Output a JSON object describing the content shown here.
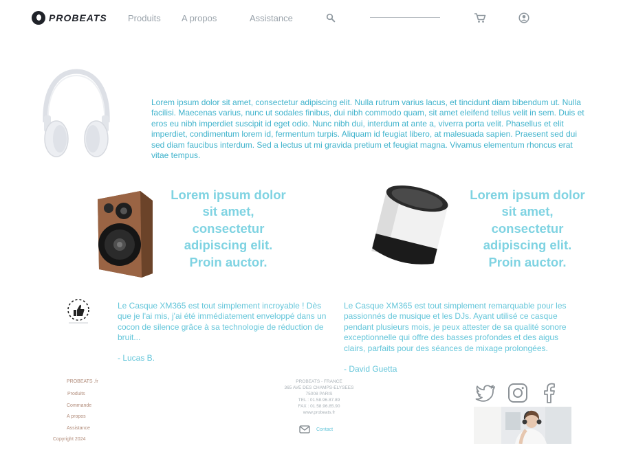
{
  "header": {
    "logo_text": "PROBEATS",
    "nav": [
      "Produits",
      "A propos",
      "Assistance"
    ],
    "icons": [
      "search-icon",
      "cart-icon",
      "account-icon"
    ]
  },
  "hero": {
    "image": "white-headphones",
    "text": "Lorem ipsum dolor sit amet, consectetur adipiscing elit. Nulla rutrum  varius lacus, et tincidunt diam bibendum ut. Nulla facilisi. Maecenas  varius, nunc ut sodales finibus, dui nibh commodo quam, sit amet  eleifend tellus velit in sem. Duis et eros eu nibh imperdiet suscipit id  eget odio. Nunc nibh dui, interdum at ante a, viverra porta velit. Phasellus et elit imperdiet, condimentum lorem id, fermentum turpis.  Aliquam id feugiat libero, at malesuada sapien. Praesent sed dui sed  diam faucibus interdum. Sed a lectus ut mi gravida pretium et feugiat  magna. Vivamus elementum rhoncus erat vitae tempus."
  },
  "promos": [
    {
      "image": "wooden-speaker",
      "text": "Lorem ipsum dolor sit amet, consectetur adipiscing elit. Proin auctor."
    },
    {
      "image": "cylinder-speaker",
      "text": "Lorem ipsum dolor sit amet, consectetur adipiscing elit. Proin auctor."
    }
  ],
  "testimonials": {
    "badge_icon": "thumbs-up-icon",
    "items": [
      {
        "quote": "Le Casque XM365 est tout simplement incroyable ! Dès que je l'ai mis, j'ai été immédiatement enveloppé dans un cocon de silence grâce à sa technologie de réduction de bruit...",
        "author": "- Lucas B."
      },
      {
        "quote": "Le Casque XM365 est tout simplement remarquable pour les passionnés de musique et les DJs. Ayant utilisé ce casque pendant plusieurs mois, je peux attester de sa qualité sonore exceptionnelle qui offre des basses profondes et des aigus clairs, parfaits pour des séances de mixage prolongées.",
        "author": "- David Guetta"
      }
    ]
  },
  "footer": {
    "links": [
      "PROBEATS .fr",
      "Produits",
      "Commande",
      "A propos",
      "Assistance"
    ],
    "copyright": "Copyright 2024",
    "address_lines": [
      "PROBEATS - FRANCE",
      "365 AVE DES CHAMPS-ELYSEES",
      "75008 PARIS",
      "TEL : 01.58.96.87.89",
      "FAX : 01.58.96.85.90",
      "www.probeats.fr"
    ],
    "contact_label": "Contact",
    "social_icons": [
      "twitter-icon",
      "instagram-icon",
      "facebook-icon"
    ],
    "photo": "woman-wearing-headphones"
  },
  "colors": {
    "accent": "#40b3cc",
    "promo": "#7fd3e2",
    "nav": "#9aa3ab",
    "logo": "#1f2229",
    "footer_link": "#b08a78"
  }
}
